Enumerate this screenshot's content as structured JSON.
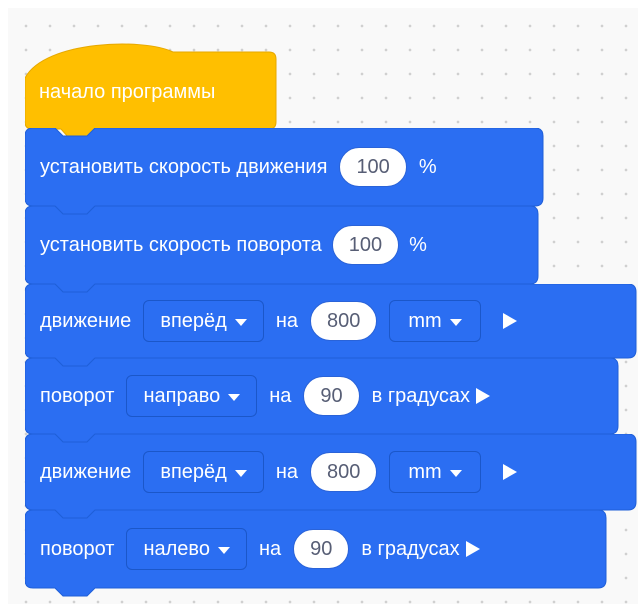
{
  "colors": {
    "hat": "#ffbf00",
    "block": "#2b6ef2",
    "workspace": "#f9f9f9"
  },
  "hat": {
    "label": "начало программы"
  },
  "blocks": [
    {
      "label": "установить скорость движения",
      "value": "100",
      "suffix": "%"
    },
    {
      "label": "установить скорость поворота",
      "value": "100",
      "suffix": "%"
    },
    {
      "label": "движение",
      "direction": "вперёд",
      "on": "на",
      "value": "800",
      "unit": "mm",
      "play_icon": "play-icon"
    },
    {
      "label": "поворот",
      "direction": "направо",
      "on": "на",
      "value": "90",
      "unit": "в градусах",
      "play_icon": "play-icon"
    },
    {
      "label": "движение",
      "direction": "вперёд",
      "on": "на",
      "value": "800",
      "unit": "mm",
      "play_icon": "play-icon"
    },
    {
      "label": "поворот",
      "direction": "налево",
      "on": "на",
      "value": "90",
      "unit": "в градусах",
      "play_icon": "play-icon"
    }
  ]
}
